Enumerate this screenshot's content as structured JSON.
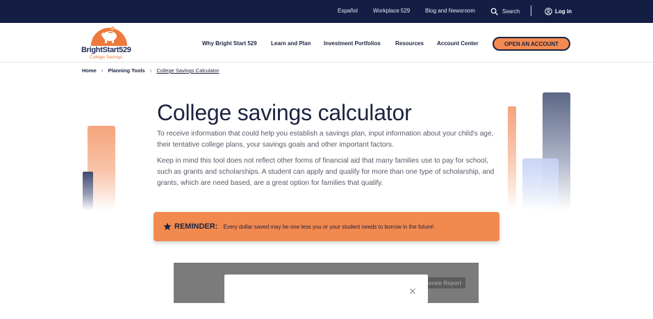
{
  "topbar": {
    "links": [
      "Español",
      "Workplace 529",
      "Blog and Newsroom"
    ],
    "search_label": "Search",
    "login_label": "Log in"
  },
  "logo": {
    "brand": "BrightStart529",
    "sub": "College Savings"
  },
  "nav": {
    "items": [
      "Why Bright Start 529",
      "Learn and Plan",
      "Investment Portfolios",
      "Resources",
      "Account Center"
    ],
    "cta": "OPEN AN ACCOUNT"
  },
  "breadcrumb": {
    "items": [
      "Home",
      "Planning Tools"
    ],
    "current": "College Savings Calculator"
  },
  "main": {
    "title": "College savings calculator",
    "paragraph1": "To receive information that could help you establish a savings plan, input information about your child's age, their tentative college plans, your savings goals and other important factors.",
    "paragraph2": "Keep in mind this tool does not reflect other forms of financial aid that many families use to pay for school, such as grants and scholarships. A student can apply and qualify for more than one type of scholarship, and grants, which are need based, are a great option for families that qualify."
  },
  "reminder": {
    "label": "REMINDER:",
    "text": "Every dollar saved may be one less you or your student needs to borrow in the future!"
  },
  "calculator": {
    "generate_button": "Generate Report"
  },
  "colors": {
    "topbar": "#141e45",
    "accent_orange": "#f2894f",
    "navy": "#1c2340"
  }
}
